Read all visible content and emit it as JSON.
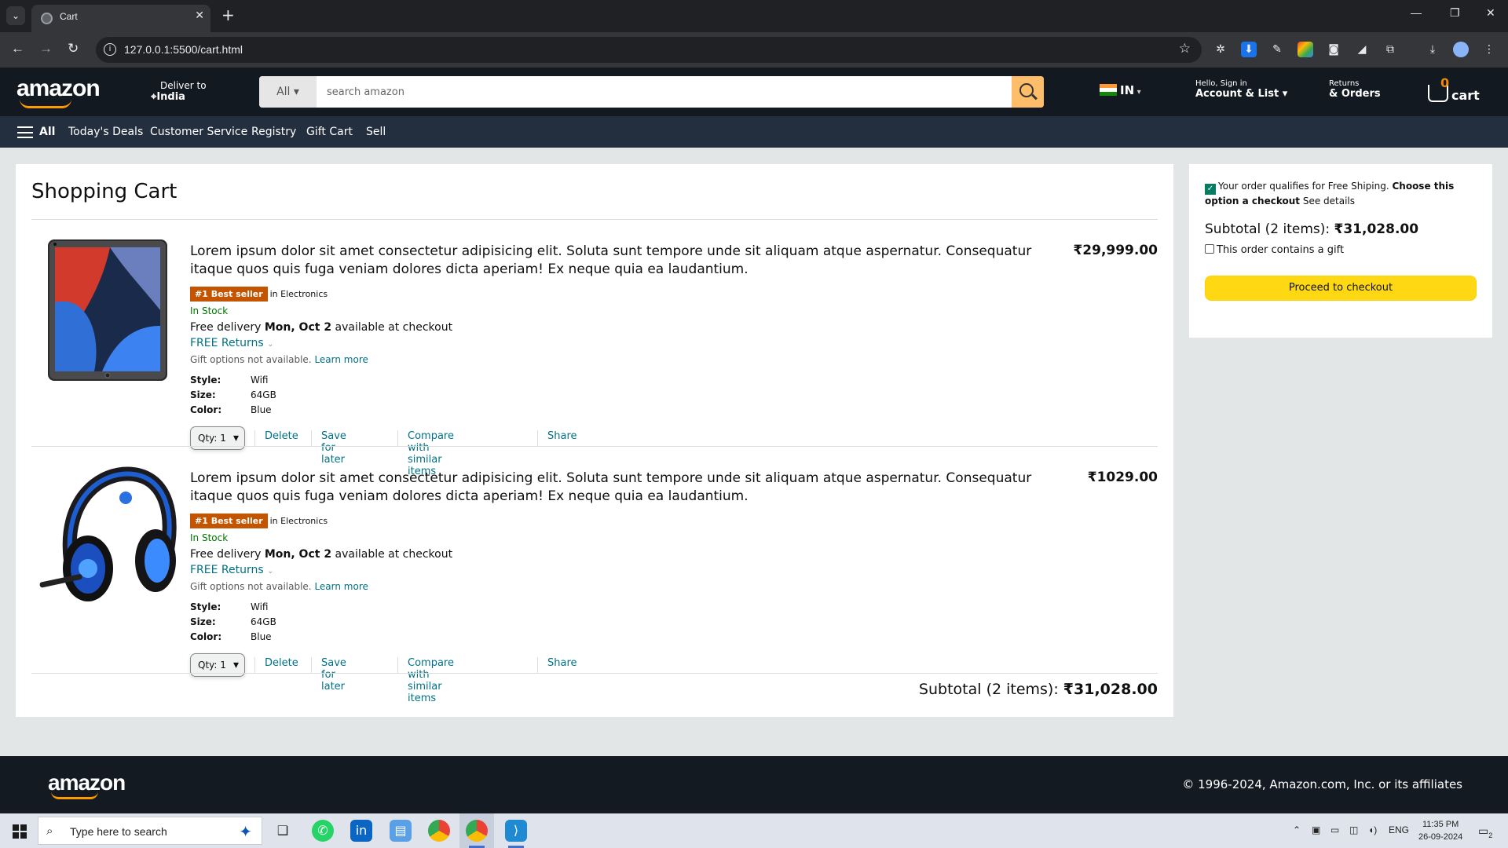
{
  "browser": {
    "tab_title": "Cart",
    "url": "127.0.0.1:5500/cart.html"
  },
  "header": {
    "logo": "amazon",
    "deliver_label": "Deliver to",
    "deliver_location": "India",
    "search_category": "All ▾",
    "search_placeholder": "search amazon",
    "lang": "IN",
    "account_small": "Hello, Sign in",
    "account_big": "Account & List ▾",
    "returns_small": "Returns",
    "returns_big": "& Orders",
    "cart_count": "0",
    "cart_label": "cart"
  },
  "nav": {
    "all": "All",
    "items": [
      "Today's Deals",
      "Customer Service",
      "Registry",
      "Gift Cart",
      "Sell"
    ]
  },
  "cart": {
    "heading": "Shopping Cart",
    "items": [
      {
        "title": "Lorem ipsum dolor sit amet consectetur adipisicing elit. Soluta sunt tempore unde sit aliquam atque aspernatur. Consequatur itaque quos quis fuga veniam dolores dicta aperiam! Ex neque quia ea laudantium.",
        "price": "₹29,999.00",
        "badge": "#1 Best seller",
        "badge_category": "in Electronics",
        "stock": "In Stock",
        "delivery_prefix": "Free delivery",
        "delivery_date": "Mon, Oct 2",
        "delivery_suffix": "available at checkout",
        "returns": "FREE Returns",
        "gift_text": "Gift options not available.",
        "gift_link": "Learn more",
        "style_label": "Style:",
        "style": "Wifi",
        "size_label": "Size:",
        "size": "64GB",
        "color_label": "Color:",
        "color": "Blue",
        "qty": "Qty: 1",
        "delete": "Delete",
        "save": "Save for later",
        "compare": "Compare with similar items",
        "share": "Share",
        "image_icon": "tablet-image"
      },
      {
        "title": "Lorem ipsum dolor sit amet consectetur adipisicing elit. Soluta sunt tempore unde sit aliquam atque aspernatur. Consequatur itaque quos quis fuga veniam dolores dicta aperiam! Ex neque quia ea laudantium.",
        "price": "₹1029.00",
        "badge": "#1 Best seller",
        "badge_category": "in Electronics",
        "stock": "In Stock",
        "delivery_prefix": "Free delivery",
        "delivery_date": "Mon, Oct 2",
        "delivery_suffix": "available at checkout",
        "returns": "FREE Returns",
        "gift_text": "Gift options not available.",
        "gift_link": "Learn more",
        "style_label": "Style:",
        "style": "Wifi",
        "size_label": "Size:",
        "size": "64GB",
        "color_label": "Color:",
        "color": "Blue",
        "qty": "Qty: 1",
        "delete": "Delete",
        "save": "Save for later",
        "compare": "Compare with similar items",
        "share": "Share",
        "image_icon": "headset-image"
      }
    ],
    "subtotal_label": "Subtotal (2 items):",
    "subtotal_value": "₹31,028.00"
  },
  "checkout": {
    "free_ship_text": "Your order qualifies for Free Shiping.",
    "free_ship_bold": "Choose this option a checkout",
    "free_ship_link": "See details",
    "subtotal_label": "Subtotal (2 items):",
    "subtotal_value": "₹31,028.00",
    "gift_label": "This order contains a gift",
    "proceed": "Proceed to checkout"
  },
  "footer": {
    "logo": "amazon",
    "copyright": "© 1996-2024, Amazon.com, Inc. or its affiliates"
  },
  "taskbar": {
    "search_placeholder": "Type here to search",
    "lang": "ENG",
    "time": "11:35 PM",
    "date": "26-09-2024",
    "notifications": "2"
  },
  "colors": {
    "header_bg": "#131921",
    "nav_bg": "#232f3e",
    "accent": "#ff9900",
    "badge": "#c45500",
    "link": "#007185",
    "button": "#ffd814"
  }
}
